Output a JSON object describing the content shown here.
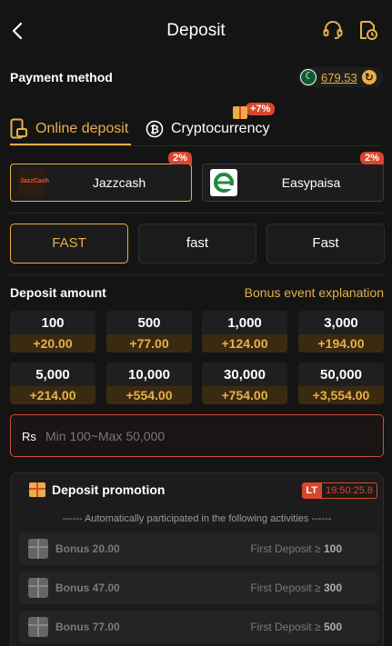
{
  "header": {
    "title": "Deposit",
    "back_icon": "chevron-left-icon",
    "support_icon": "headset-icon",
    "history_icon": "history-icon"
  },
  "payment": {
    "label": "Payment method",
    "balance": "679.53",
    "tabs": [
      {
        "label": "Online deposit",
        "active": true
      },
      {
        "label": "Cryptocurrency",
        "active": false,
        "badge": "+7%"
      }
    ],
    "channels": [
      {
        "name": "Jazzcash",
        "logo_text": "JazzCash",
        "badge": "2%",
        "active": true
      },
      {
        "name": "Easypaisa",
        "badge": "2%",
        "active": false
      }
    ],
    "speeds": [
      {
        "label": "FAST",
        "active": true
      },
      {
        "label": "fast",
        "active": false
      },
      {
        "label": "Fast",
        "active": false
      }
    ]
  },
  "amount": {
    "label": "Deposit amount",
    "bonus_link": "Bonus event explanation",
    "options": [
      {
        "value": "100",
        "bonus": "+20.00"
      },
      {
        "value": "500",
        "bonus": "+77.00"
      },
      {
        "value": "1,000",
        "bonus": "+124.00"
      },
      {
        "value": "3,000",
        "bonus": "+194.00"
      },
      {
        "value": "5,000",
        "bonus": "+214.00"
      },
      {
        "value": "10,000",
        "bonus": "+554.00"
      },
      {
        "value": "30,000",
        "bonus": "+754.00"
      },
      {
        "value": "50,000",
        "bonus": "+3,554.00"
      }
    ],
    "currency": "Rs",
    "placeholder": "Min 100~Max 50,000"
  },
  "promotion": {
    "title": "Deposit promotion",
    "lt": "LT",
    "timer": "19:50:25.8",
    "note": "------ Automatically participated in the following activities ------",
    "rows": [
      {
        "bonus": "Bonus 20.00",
        "condition": "First Deposit ≥",
        "min": "100"
      },
      {
        "bonus": "Bonus 47.00",
        "condition": "First Deposit ≥",
        "min": "300"
      },
      {
        "bonus": "Bonus 77.00",
        "condition": "First Deposit ≥",
        "min": "500"
      }
    ]
  },
  "colors": {
    "accent": "#e8b047",
    "danger": "#d9472b",
    "background": "#141414"
  }
}
